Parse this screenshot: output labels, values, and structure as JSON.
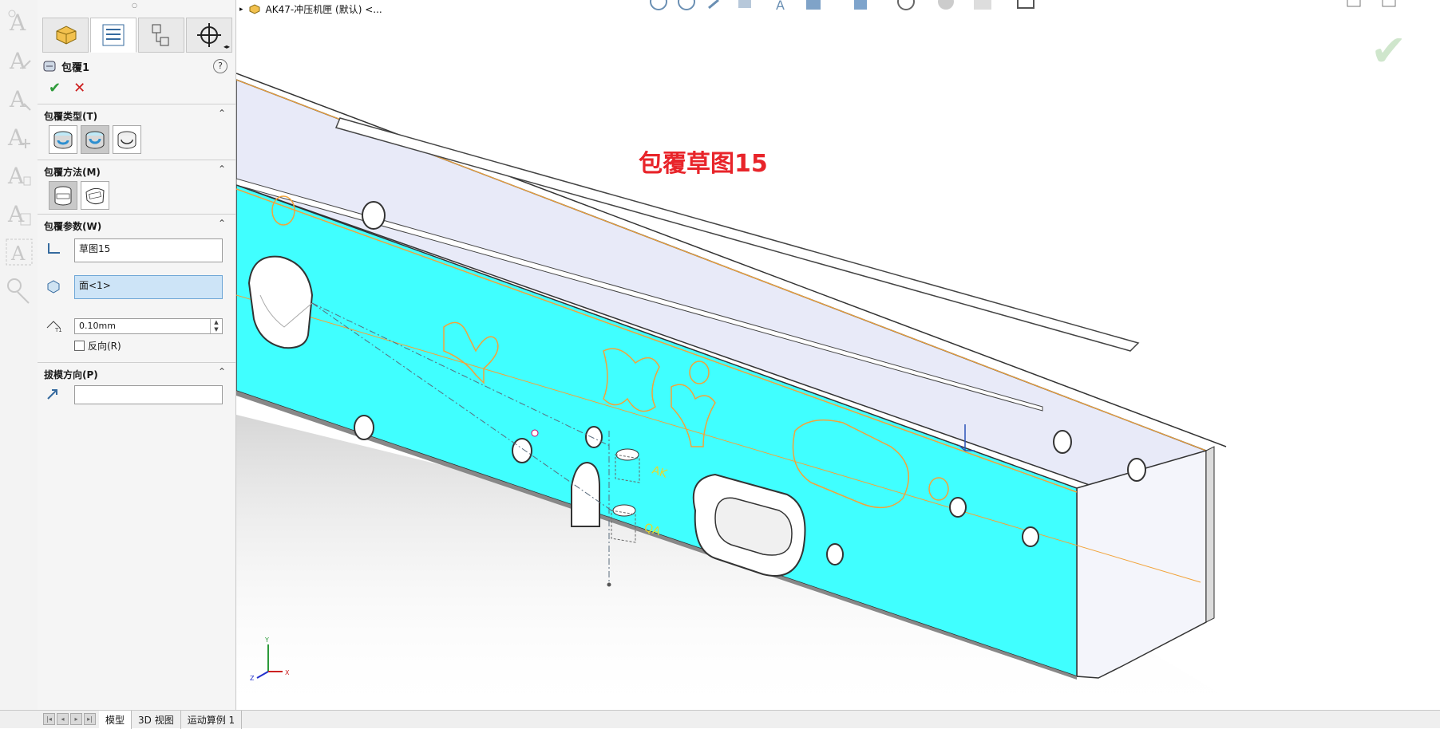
{
  "breadcrumb": {
    "doc_label": "AK47-冲压机匣 (默认) <..."
  },
  "property_manager": {
    "feature_title": "包覆1",
    "help_label": "?",
    "ok_label": "✔",
    "cancel_label": "✕",
    "sections": {
      "wrap_type": {
        "header": "包覆类型(T)"
      },
      "wrap_method": {
        "header": "包覆方法(M)"
      },
      "wrap_params": {
        "header": "包覆参数(W)",
        "sketch_value": "草图15",
        "face_value": "面<1>",
        "thickness_value": "0.10mm",
        "reverse_label": "反向(R)"
      },
      "draft": {
        "header": "拔模方向(P)",
        "value": ""
      }
    }
  },
  "viewport": {
    "annotation": "包覆草图15",
    "triad": {
      "x": "X",
      "y": "Y",
      "z": "Z"
    }
  },
  "bottom_tabs": [
    "模型",
    "3D 视图",
    "运动算例 1"
  ],
  "colors": {
    "face_cyan": "#40ffff",
    "edge_orange": "#f2a33a",
    "annot_red": "#e8242a",
    "ok_green": "#2f9b3a",
    "cancel_red": "#cc1a1a"
  }
}
